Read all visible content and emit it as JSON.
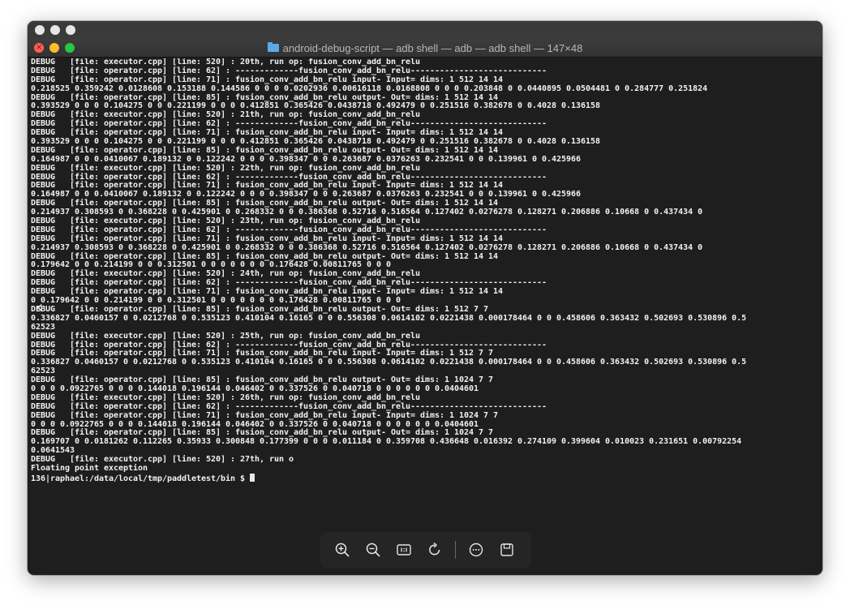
{
  "terminal": {
    "title": "android-debug-script — adb shell — adb — adb shell — 147×48",
    "lines": [
      "DEBUG   [file: executor.cpp] [line: 520] : 20th, run op: fusion_conv_add_bn_relu",
      "DEBUG   [file: operator.cpp] [line: 62] : -------------fusion_conv_add_bn_relu----------------------------",
      "DEBUG   [file: operator.cpp] [line: 71] : fusion_conv_add_bn_relu input- Input= dims: 1 512 14 14",
      "0.218525 0.359242 0.0128608 0.153188 0.144586 0 0 0 0.0202936 0.00616118 0.0168808 0 0 0 0.203848 0 0.0440895 0.0504481 0 0.284777 0.251824",
      "DEBUG   [file: operator.cpp] [line: 85] : fusion_conv_add_bn_relu output- Out= dims: 1 512 14 14",
      "0.393529 0 0 0 0.104275 0 0 0.221199 0 0 0 0.412851 0.365426 0.0438718 0.492479 0 0.251516 0.382678 0 0.4028 0.136158",
      "DEBUG   [file: executor.cpp] [line: 520] : 21th, run op: fusion_conv_add_bn_relu",
      "DEBUG   [file: operator.cpp] [line: 62] : -------------fusion_conv_add_bn_relu----------------------------",
      "DEBUG   [file: operator.cpp] [line: 71] : fusion_conv_add_bn_relu input- Input= dims: 1 512 14 14",
      "0.393529 0 0 0 0.104275 0 0 0.221199 0 0 0 0.412851 0.365426 0.0438718 0.492479 0 0.251516 0.382678 0 0.4028 0.136158",
      "DEBUG   [file: operator.cpp] [line: 85] : fusion_conv_add_bn_relu output- Out= dims: 1 512 14 14",
      "0.164987 0 0 0.0410067 0.189132 0 0.122242 0 0 0 0.398347 0 0 0.263687 0.0376263 0.232541 0 0 0.139961 0 0.425966",
      "DEBUG   [file: executor.cpp] [line: 520] : 22th, run op: fusion_conv_add_bn_relu",
      "DEBUG   [file: operator.cpp] [line: 62] : -------------fusion_conv_add_bn_relu----------------------------",
      "DEBUG   [file: operator.cpp] [line: 71] : fusion_conv_add_bn_relu input- Input= dims: 1 512 14 14",
      "0.164987 0 0 0.0410067 0.189132 0 0.122242 0 0 0 0.398347 0 0 0.263687 0.0376263 0.232541 0 0 0.139961 0 0.425966",
      "DEBUG   [file: operator.cpp] [line: 85] : fusion_conv_add_bn_relu output- Out= dims: 1 512 14 14",
      "0.214937 0.308593 0 0.368228 0 0.425901 0 0.268332 0 0 0.386368 0.52716 0.516564 0.127402 0.0276278 0.128271 0.206886 0.10668 0 0.437434 0",
      "DEBUG   [file: executor.cpp] [line: 520] : 23th, run op: fusion_conv_add_bn_relu",
      "DEBUG   [file: operator.cpp] [line: 62] : -------------fusion_conv_add_bn_relu----------------------------",
      "DEBUG   [file: operator.cpp] [line: 71] : fusion_conv_add_bn_relu input- Input= dims: 1 512 14 14",
      "0.214937 0.308593 0 0.368228 0 0.425901 0 0.268332 0 0 0.386368 0.52716 0.516564 0.127402 0.0276278 0.128271 0.206886 0.10668 0 0.437434 0",
      "DEBUG   [file: operator.cpp] [line: 85] : fusion_conv_add_bn_relu output- Out= dims: 1 512 14 14",
      "0.179642 0 0 0.214199 0 0 0.312501 0 0 0 0 0 0 0 0.176428 0.00811765 0 0 0",
      "DEBUG   [file: executor.cpp] [line: 520] : 24th, run op: fusion_conv_add_bn_relu",
      "DEBUG   [file: operator.cpp] [line: 62] : -------------fusion_conv_add_bn_relu----------------------------",
      "DEBUG   [file: operator.cpp] [line: 71] : fusion_conv_add_bn_relu input- Input= dims: 1 512 14 14",
      "0 0.179642 0 0 0.214199 0 0 0.312501 0 0 0 0 0 0 0 0.176428 0.00811765 0 0 0",
      "DEBUG   [file: operator.cpp] [line: 85] : fusion_conv_add_bn_relu output- Out= dims: 1 512 7 7",
      "0.336827 0.0460157 0 0.0212768 0 0.535123 0.410104 0.16165 0 0 0.556308 0.0614102 0.0221438 0.000178464 0 0 0.458606 0.363432 0.502693 0.530896 0.5",
      "62523",
      "DEBUG   [file: executor.cpp] [line: 520] : 25th, run op: fusion_conv_add_bn_relu",
      "DEBUG   [file: operator.cpp] [line: 62] : -------------fusion_conv_add_bn_relu----------------------------",
      "DEBUG   [file: operator.cpp] [line: 71] : fusion_conv_add_bn_relu input- Input= dims: 1 512 7 7",
      "0.336827 0.0460157 0 0.0212768 0 0.535123 0.410104 0.16165 0 0 0.556308 0.0614102 0.0221438 0.000178464 0 0 0.458606 0.363432 0.502693 0.530896 0.5",
      "62523",
      "DEBUG   [file: operator.cpp] [line: 85] : fusion_conv_add_bn_relu output- Out= dims: 1 1024 7 7",
      "0 0 0 0.0922765 0 0 0 0.144018 0.196144 0.046402 0 0.337526 0 0.040718 0 0 0 0 0 0 0.0404601",
      "DEBUG   [file: executor.cpp] [line: 520] : 26th, run op: fusion_conv_add_bn_relu",
      "DEBUG   [file: operator.cpp] [line: 62] : -------------fusion_conv_add_bn_relu----------------------------",
      "DEBUG   [file: operator.cpp] [line: 71] : fusion_conv_add_bn_relu input- Input= dims: 1 1024 7 7",
      "0 0 0 0.0922765 0 0 0 0.144018 0.196144 0.046402 0 0.337526 0 0.040718 0 0 0 0 0 0 0.0404601",
      "DEBUG   [file: operator.cpp] [line: 85] : fusion_conv_add_bn_relu output- Out= dims: 1 1024 7 7",
      "0.169707 0 0.0181262 0.112265 0.35933 0.300848 0.177399 0 0 0 0.011184 0 0.359708 0.436648 0.016392 0.274109 0.399604 0.010023 0.231651 0.00792254",
      "0.0641543",
      "DEBUG   [file: executor.cpp] [line: 520] : 27th, run o",
      "Floating point exception"
    ],
    "prompt": "136|raphael:/data/local/tmp/paddletest/bin $ "
  },
  "toolbar": {
    "icons": [
      "zoom-in-icon",
      "zoom-out-icon",
      "actual-size-icon",
      "rotate-icon",
      "more-icon",
      "save-icon"
    ]
  }
}
